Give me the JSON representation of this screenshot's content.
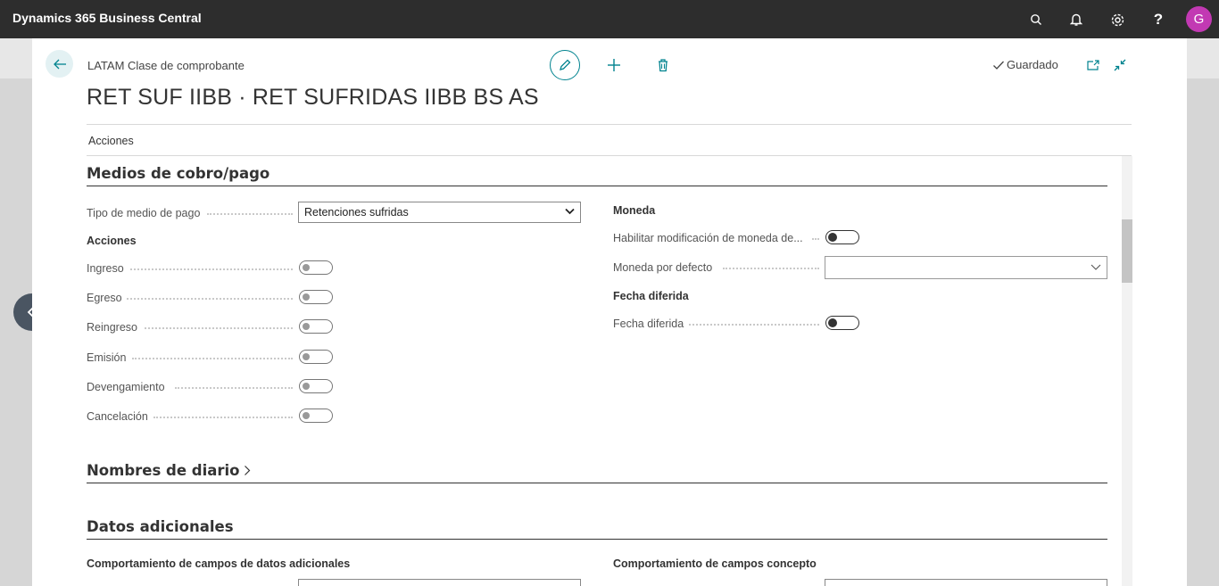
{
  "app": {
    "title": "Dynamics 365 Business Central",
    "user_initial": "G",
    "avatar_color": "#c239b3",
    "accent": "#00838f"
  },
  "header": {
    "breadcrumb": "LATAM Clase de comprobante",
    "title": "RET SUF IIBB · RET SUFRIDAS IIBB BS AS",
    "status": "Guardado",
    "actions_tab": "Acciones"
  },
  "sections": {
    "medios": {
      "title": "Medios de cobro/pago",
      "payment_type_label": "Tipo de medio de pago",
      "payment_type_value": "Retenciones sufridas",
      "acciones_group": "Acciones",
      "toggles": [
        {
          "label": "Ingreso",
          "on": false
        },
        {
          "label": "Egreso",
          "on": false
        },
        {
          "label": "Reingreso",
          "on": false
        },
        {
          "label": "Emisión",
          "on": false
        },
        {
          "label": "Devengamiento",
          "on": false
        },
        {
          "label": "Cancelación",
          "on": false
        }
      ],
      "moneda_group": "Moneda",
      "habilitar_label": "Habilitar modificación de moneda de...",
      "moneda_defecto_label": "Moneda por defecto",
      "moneda_defecto_value": "",
      "fecha_group": "Fecha diferida",
      "fecha_label": "Fecha diferida"
    },
    "nombres": {
      "title": "Nombres de diario"
    },
    "datos": {
      "title": "Datos adicionales",
      "left_group": "Comportamiento de campos de datos adicionales",
      "right_group": "Comportamiento de campos concepto"
    }
  }
}
